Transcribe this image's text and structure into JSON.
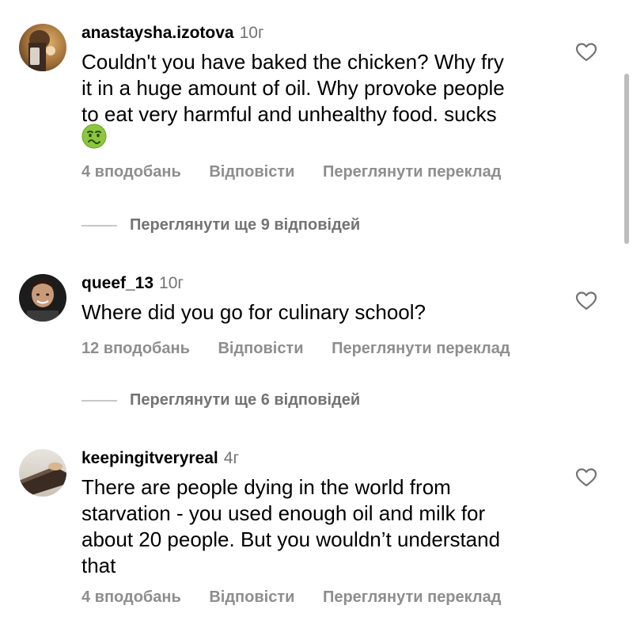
{
  "comments": [
    {
      "username": "anastaysha.izotova",
      "time": "10г",
      "text": "Couldn't you have baked the chicken? Why fry\nit in a huge amount of oil.  Why provoke people\nto eat very harmful and unhealthy food. sucks",
      "emoji": "nauseated-face-icon",
      "likes": "4 вподобань",
      "reply": "Відповісти",
      "translate": "Переглянути переклад",
      "view_replies": "Переглянути ще 9 відповідей"
    },
    {
      "username": "queef_13",
      "time": "10г",
      "text": "Where did you go for culinary school?",
      "likes": "12 вподобань",
      "reply": "Відповісти",
      "translate": "Переглянути переклад",
      "view_replies": "Переглянути ще 6 відповідей"
    },
    {
      "username": "keepingitveryreal",
      "time": "4г",
      "text": "There are people dying in the world from\nstarvation - you used enough oil and milk for\nabout 20 people. But you wouldn’t understand\nthat",
      "likes": "4 вподобань",
      "reply": "Відповісти",
      "translate": "Переглянути переклад"
    }
  ],
  "colors": {
    "username": "#000000",
    "meta": "#8e8e8e",
    "divider": "#c7c7c7",
    "scrollbar": "#bdbdbd"
  }
}
